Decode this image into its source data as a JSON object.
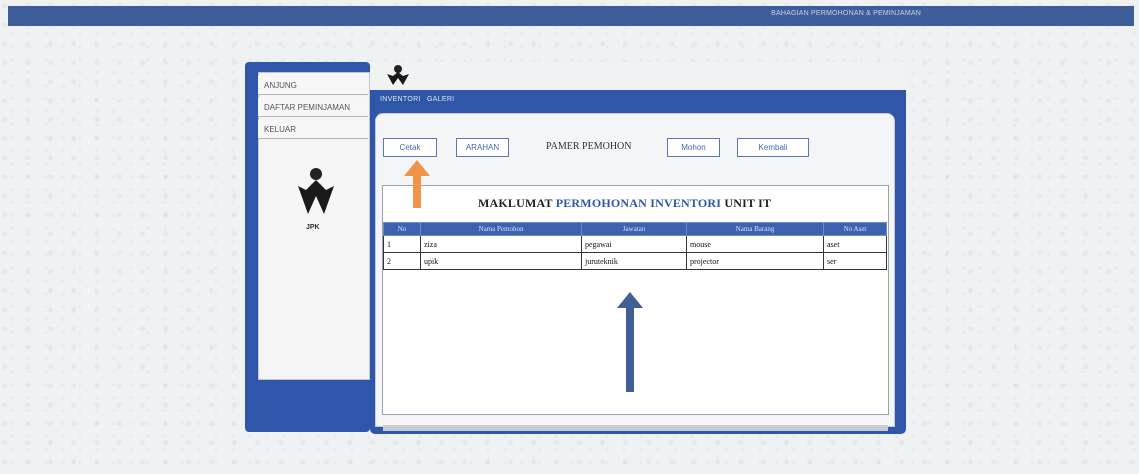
{
  "header": {
    "title": "BAHAGIAN PERMOHONAN & PEMINJAMAN"
  },
  "sidebar": {
    "items": [
      {
        "label": "ANJUNG"
      },
      {
        "label": "DAFTAR PEMINJAMAN"
      },
      {
        "label": "KELUAR"
      }
    ],
    "logo_caption": "JPK"
  },
  "nav": {
    "links": [
      "INVENTORI",
      "GALERI"
    ]
  },
  "toolbar": {
    "cetak_label": "Cetak",
    "arahan_label": "ARAHAN",
    "pamer_label": "PAMER PEMOHON",
    "mohon_label": "Mohon",
    "kembali_label": "Kembali"
  },
  "report": {
    "title_part1": "MAKLUMAT",
    "title_part2": "PERMOHONAN INVENTORI",
    "title_part3": "UNIT IT",
    "columns": [
      "No",
      "Nama Pemohon",
      "Jawatan",
      "Nama Barang",
      "No Aset"
    ],
    "rows": [
      [
        "1",
        "ziza",
        "pegawai",
        "mouse",
        "aset"
      ],
      [
        "2",
        "upik",
        "juruteknik",
        "projector",
        "ser"
      ]
    ]
  },
  "colors": {
    "brand_blue": "#2f56a8",
    "arrow_orange": "#f0944a",
    "arrow_blue": "#3f5f95"
  }
}
